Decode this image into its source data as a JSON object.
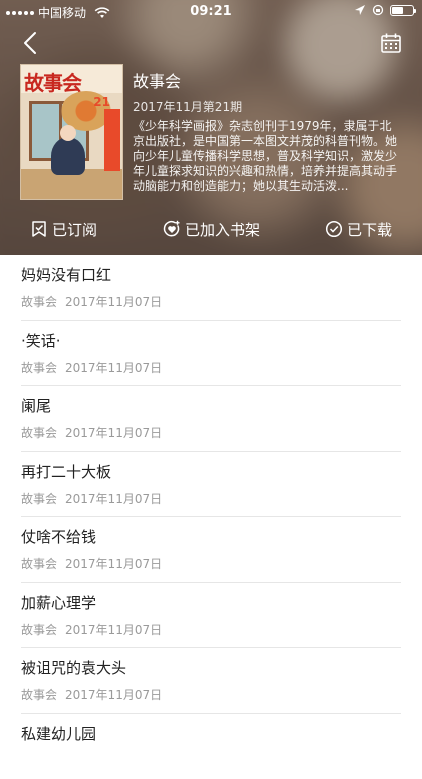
{
  "status_bar": {
    "carrier": "中国移动",
    "time": "09:21"
  },
  "magazine": {
    "title": "故事会",
    "issue": "2017年11月第21期",
    "description": "《少年科学画报》杂志创刊于1979年，隶属于北京出版社，是中国第一本图文并茂的科普刊物。她向少年儿童传播科学思想，普及科学知识，激发少年儿童探求知识的兴趣和热情，培养并提高其动手动脑能力和创造能力；她以其生动活泼...",
    "cover_logo": "故事会",
    "cover_issue_number": "21"
  },
  "actions": {
    "subscribed": "已订阅",
    "shelf": "已加入书架",
    "downloaded": "已下载"
  },
  "articles": [
    {
      "title": "妈妈没有口红",
      "source": "故事会",
      "date": "2017年11月07日"
    },
    {
      "title": "·笑话·",
      "source": "故事会",
      "date": "2017年11月07日"
    },
    {
      "title": "阑尾",
      "source": "故事会",
      "date": "2017年11月07日"
    },
    {
      "title": "再打二十大板",
      "source": "故事会",
      "date": "2017年11月07日"
    },
    {
      "title": "仗啥不给钱",
      "source": "故事会",
      "date": "2017年11月07日"
    },
    {
      "title": "加薪心理学",
      "source": "故事会",
      "date": "2017年11月07日"
    },
    {
      "title": "被诅咒的袁大头",
      "source": "故事会",
      "date": "2017年11月07日"
    },
    {
      "title": "私建幼儿园",
      "source": "",
      "date": ""
    }
  ],
  "icons": {
    "back": "chevron-left-icon",
    "calendar": "calendar-icon",
    "subscribe": "bookmark-check-icon",
    "shelf": "heart-plus-icon",
    "download": "check-circle-icon"
  }
}
